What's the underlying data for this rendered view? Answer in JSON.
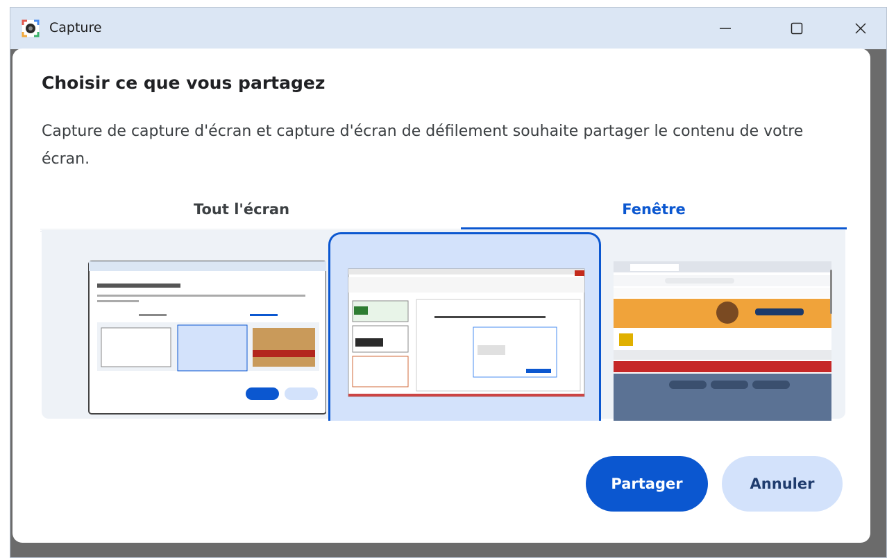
{
  "window": {
    "title": "Capture",
    "icon": "camera-app-icon",
    "controls": [
      "minimize-icon",
      "maximize-icon",
      "close-icon"
    ]
  },
  "dialog": {
    "title": "Choisir ce que vous partagez",
    "description": "Capture de capture d'écran et capture d'écran de défilement souhaite partager le contenu de votre écran.",
    "tabs": [
      {
        "label": "Tout l'écran",
        "selected": false
      },
      {
        "label": "Fenêtre",
        "selected": true
      }
    ],
    "buttons": {
      "share": "Partager",
      "cancel": "Annuler"
    }
  },
  "colors": {
    "accent": "#0b57d0",
    "accent_light": "#d3e2fb",
    "titlebar": "#dbe6f4"
  }
}
